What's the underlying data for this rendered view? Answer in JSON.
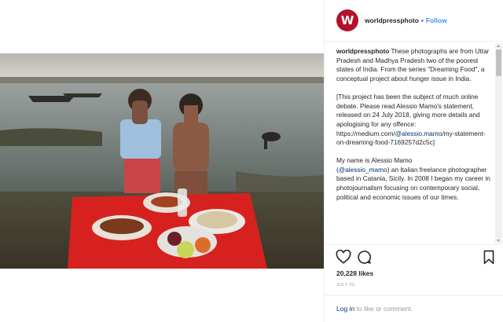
{
  "header": {
    "avatar_letter": "W",
    "username": "worldpressphoto",
    "separator": "•",
    "follow_label": "Follow"
  },
  "comments": [
    {
      "username": "worldpressphoto",
      "text": " These photographs are from Uttar Pradesh and Madhya Pradesh two of the poorest states of India. From the series \"Dreaming Food\", a conceptual project about hunger issue in India."
    },
    {
      "text_before": "[This project has been the subject of much online debate. Please read Alessio Mamo's statement, released on 24 July 2018, giving more details and apologising for any offence:\nhttps://medium.com/",
      "link": "@alessio.mamo",
      "text_after": "/my-statement-on-dreaming-food-7169257d2c5c]"
    },
    {
      "text_before": "My name is Alessio Mamo\n(",
      "link": "@alessio_mamo",
      "text_after": ") an Italian freelance photographer based in Catania, Sicily. In 2008 I began my career in photojournalism focusing on contemporary social, political and economic issues of our times."
    }
  ],
  "likes": "20,228 likes",
  "date": "JULY 22",
  "footer": {
    "login_label": "Log in",
    "rest": " to like or comment."
  },
  "icons": {
    "like": "heart-icon",
    "comment": "comment-icon",
    "save": "bookmark-icon"
  },
  "colors": {
    "brand": "#b3122a",
    "link": "#003569",
    "follow": "#3897f0",
    "muted": "#999999"
  }
}
